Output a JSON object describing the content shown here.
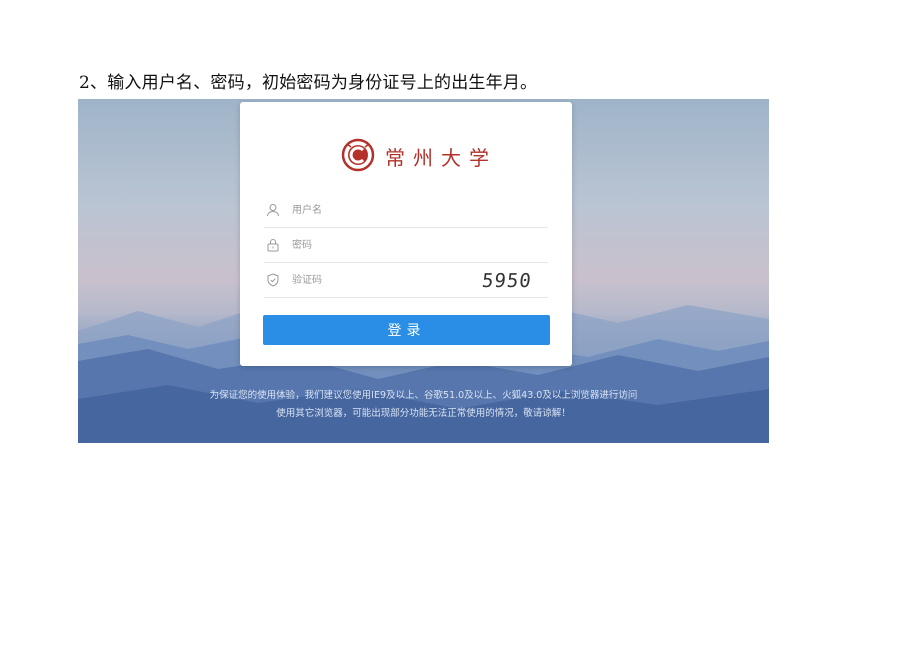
{
  "document": {
    "instruction": "2、输入用户名、密码，初始密码为身份证号上的出生年月。"
  },
  "login": {
    "logo_text": "常州大学",
    "username_placeholder": "用户名",
    "password_placeholder": "密码",
    "captcha_placeholder": "验证码",
    "captcha_code": "5950",
    "submit_label": "登录",
    "icons": {
      "user": "user-icon",
      "password": "lock-icon",
      "captcha": "shield-icon",
      "logo": "university-logo-icon"
    }
  },
  "notice": {
    "line1": "为保证您的使用体验，我们建议您使用IE9及以上、谷歌51.0及以上、火狐43.0及以上浏览器进行访问",
    "line2": "使用其它浏览器，可能出现部分功能无法正常使用的情况，敬请谅解！"
  },
  "colors": {
    "brand_red": "#b3312a",
    "button_blue": "#2a8de6"
  }
}
